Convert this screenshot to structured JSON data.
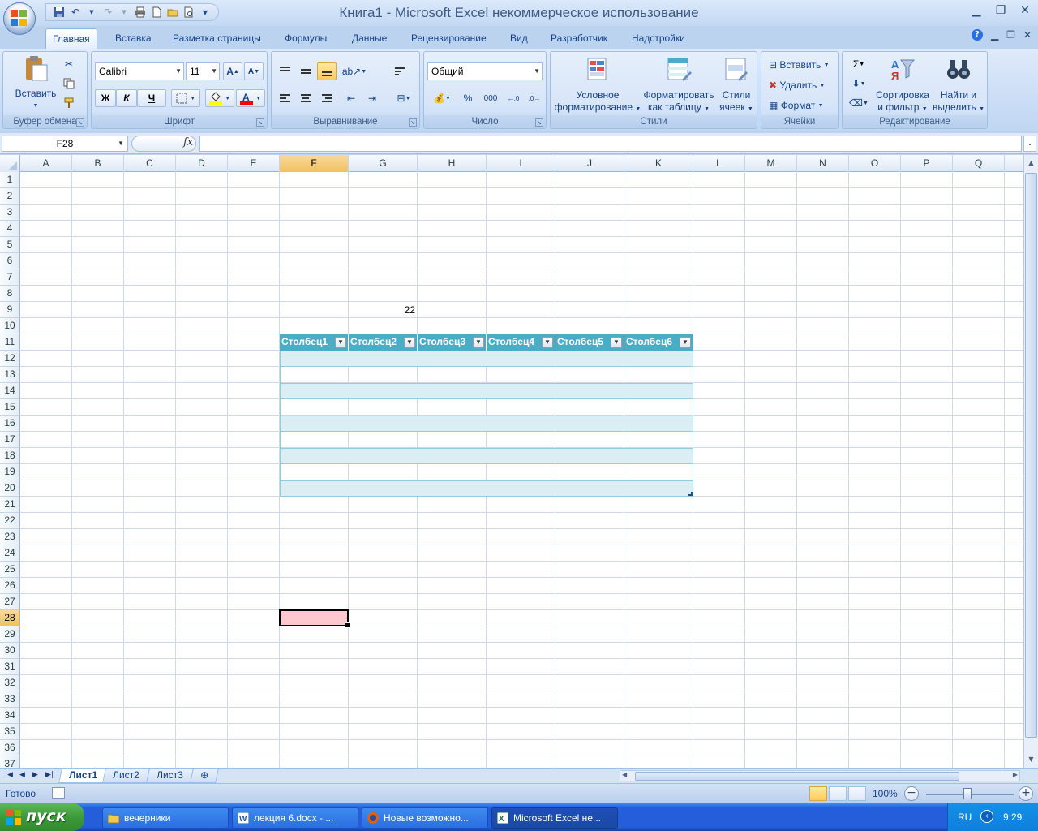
{
  "window": {
    "title": "Книга1 - Microsoft Excel некоммерческое использование"
  },
  "qat_icons": [
    "save-icon",
    "undo-icon",
    "redo-icon",
    "print-icon",
    "new-icon",
    "open-icon",
    "print-preview-icon",
    "customize-icon"
  ],
  "tabs": [
    {
      "label": "Главная",
      "active": true
    },
    {
      "label": "Вставка"
    },
    {
      "label": "Разметка страницы"
    },
    {
      "label": "Формулы"
    },
    {
      "label": "Данные"
    },
    {
      "label": "Рецензирование"
    },
    {
      "label": "Вид"
    },
    {
      "label": "Разработчик"
    },
    {
      "label": "Надстройки"
    }
  ],
  "ribbon": {
    "clipboard": {
      "label": "Буфер обмена",
      "paste": "Вставить"
    },
    "font": {
      "label": "Шрифт",
      "font_name": "Calibri",
      "font_size": "11",
      "bold": "Ж",
      "italic": "К",
      "underline": "Ч"
    },
    "alignment": {
      "label": "Выравнивание"
    },
    "number": {
      "label": "Число",
      "format": "Общий",
      "percent": "%",
      "thousands": "000"
    },
    "styles": {
      "label": "Стили",
      "cond_line1": "Условное",
      "cond_line2": "форматирование",
      "table_line1": "Форматировать",
      "table_line2": "как таблицу",
      "cell_line1": "Стили",
      "cell_line2": "ячеек"
    },
    "cells": {
      "label": "Ячейки",
      "insert": "Вставить",
      "delete": "Удалить",
      "format": "Формат"
    },
    "editing": {
      "label": "Редактирование",
      "sort_line1": "Сортировка",
      "sort_line2": "и фильтр",
      "find_line1": "Найти и",
      "find_line2": "выделить"
    }
  },
  "formula_bar": {
    "name_box": "F28",
    "fx": "fx",
    "value": ""
  },
  "columns": [
    "A",
    "B",
    "C",
    "D",
    "E",
    "F",
    "G",
    "H",
    "I",
    "J",
    "K",
    "L",
    "M",
    "N",
    "O",
    "P",
    "Q"
  ],
  "rows": [
    "1",
    "2",
    "3",
    "4",
    "5",
    "6",
    "7",
    "8",
    "9",
    "10",
    "11",
    "12",
    "13",
    "14",
    "15",
    "16",
    "17",
    "18",
    "19",
    "20",
    "21",
    "22",
    "23",
    "24",
    "25",
    "26",
    "27",
    "28",
    "29",
    "30",
    "31",
    "32",
    "33",
    "34",
    "35",
    "36",
    "37"
  ],
  "cells": {
    "G9": "22"
  },
  "table": {
    "headers": [
      "Столбец1",
      "Столбец2",
      "Столбец3",
      "Столбец4",
      "Столбец5",
      "Столбец6"
    ],
    "header_color": "#4bacc6",
    "band_color": "#daeef3"
  },
  "active_cell": {
    "ref": "F28",
    "fill": "#ffc7ce"
  },
  "sheet_tabs": [
    {
      "label": "Лист1",
      "active": true
    },
    {
      "label": "Лист2"
    },
    {
      "label": "Лист3"
    }
  ],
  "status": {
    "text": "Готово",
    "zoom": "100%"
  },
  "taskbar": {
    "start": "пуск",
    "items": [
      {
        "label": "вечерники",
        "icon": "folder-icon"
      },
      {
        "label": "лекция 6.docx - ...",
        "icon": "word-icon"
      },
      {
        "label": "Новые возможно...",
        "icon": "firefox-icon"
      },
      {
        "label": "Microsoft Excel не...",
        "icon": "excel-icon",
        "active": true
      }
    ],
    "lang": "RU",
    "time": "9:29"
  }
}
